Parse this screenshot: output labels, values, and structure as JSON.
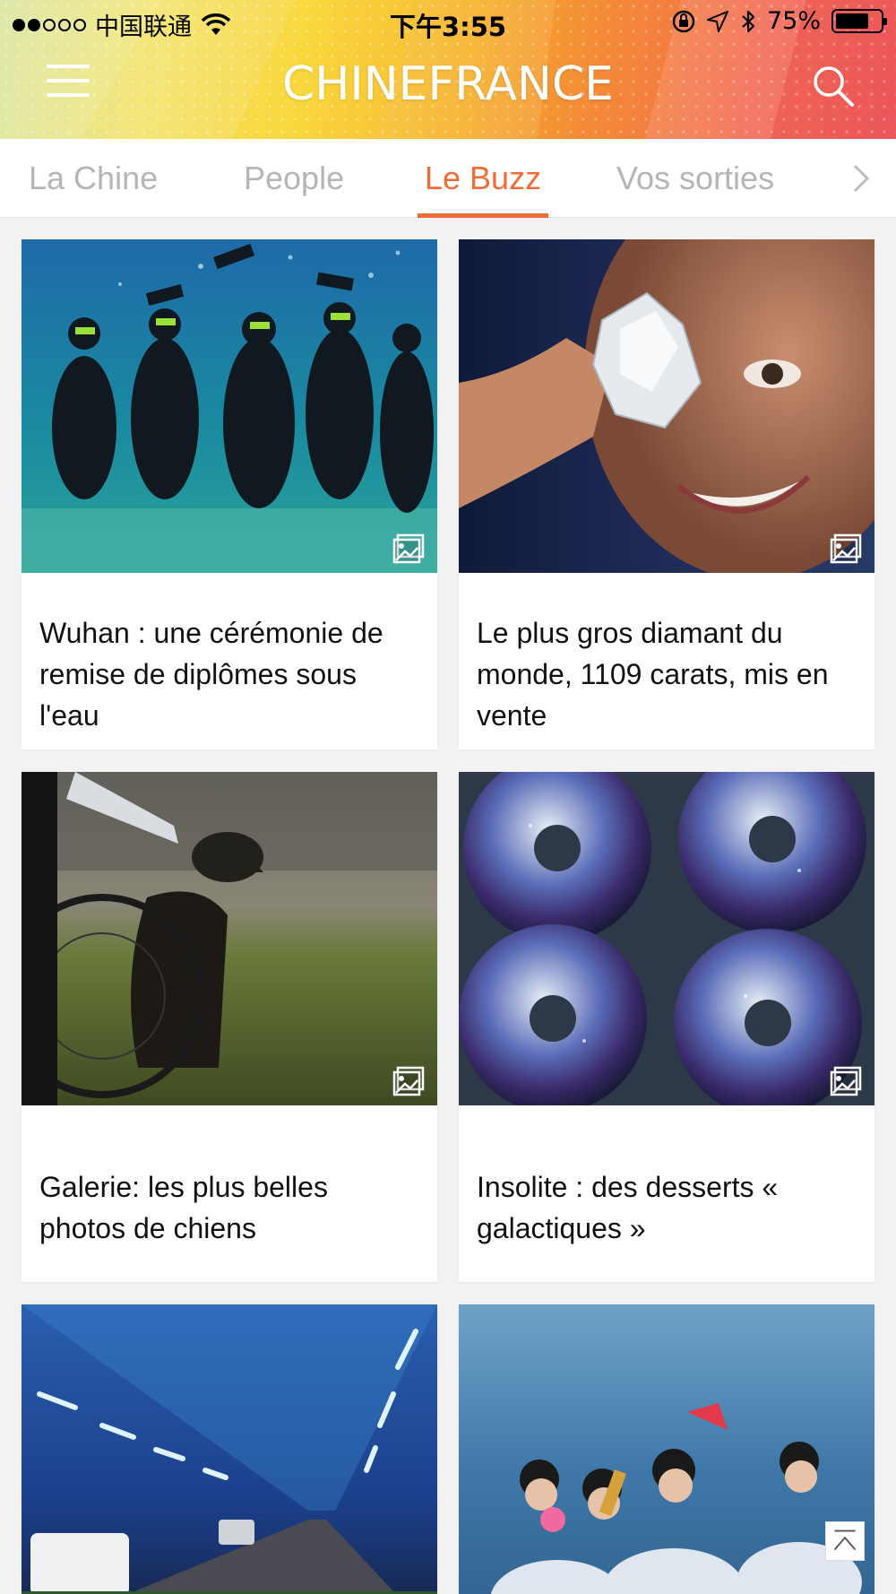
{
  "status_bar": {
    "carrier": "中国联通",
    "time": "下午3:55",
    "battery": "75%",
    "battery_level": 0.75
  },
  "header": {
    "brand": "CHINEFRANCE",
    "menu_icon": "menu-icon",
    "search_icon": "search-icon"
  },
  "tabs": [
    {
      "label": "La Chine"
    },
    {
      "label": "People"
    },
    {
      "label": "Le Buzz"
    },
    {
      "label": "Vos sorties"
    }
  ],
  "active_tab": "Le Buzz",
  "accent_color": "#ef6c36",
  "articles": [
    {
      "title": "Wuhan : une cérémonie de remise de diplômes sous l'eau",
      "icon": "gallery-icon"
    },
    {
      "title": "Le plus gros diamant du monde, 1109 carats, mis en vente",
      "icon": "gallery-icon"
    },
    {
      "title": "Galerie: les plus belles photos de chiens",
      "icon": "gallery-icon"
    },
    {
      "title": "Insolite : des desserts « galactiques »",
      "icon": "gallery-icon"
    },
    {
      "title": ""
    },
    {
      "title": ""
    }
  ]
}
